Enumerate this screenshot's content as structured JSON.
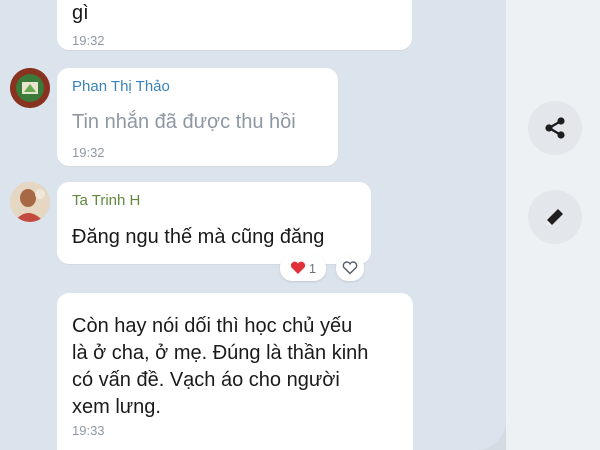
{
  "messages": [
    {
      "text": "gì",
      "time": "19:32"
    },
    {
      "sender": "Phan Thị Thảo",
      "text": "Tin nhắn đã được thu hồi",
      "time": "19:32"
    },
    {
      "sender": "Ta Trinh H",
      "text": "Đăng ngu thế mà cũng đăng",
      "reaction_count": "1"
    },
    {
      "lines": [
        "Còn hay nói dối thì học chủ yếu",
        "là ở cha, ở mẹ. Đúng là thần kinh",
        "có vấn đề. Vạch áo cho người",
        "xem lưng."
      ],
      "time": "19:33"
    }
  ],
  "icons": {
    "share": "share-icon",
    "edit": "pencil-icon",
    "heart_reaction": "heart-icon",
    "heart_outline": "heart-outline-icon"
  },
  "colors": {
    "chat_background": "#dbe3ec",
    "sender_phan": "#3a82b8",
    "sender_ta": "#5f8a3e",
    "recalled_text": "#8e98a3",
    "heart": "#e0303a"
  }
}
